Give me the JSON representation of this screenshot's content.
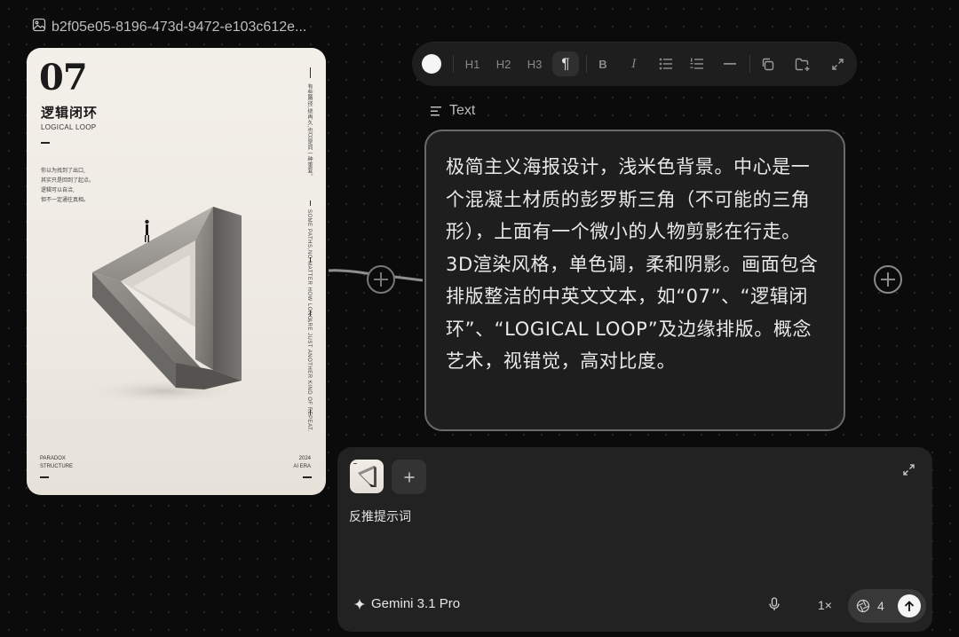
{
  "image_node": {
    "label": "b2f05e05-8196-473d-9472-e103c612e..."
  },
  "poster": {
    "number": "07",
    "title_cn": "逻辑闭环",
    "title_en": "LOGICAL LOOP",
    "poem_lines": [
      "你以为找到了出口,",
      "其实只是回到了起点。",
      "逻辑可以自洽,",
      "但不一定通往真相。"
    ],
    "vertical_cn": "有些路径,绕再久,也只是同一种重复。",
    "vertical_en_1": "SOME PATHS,",
    "vertical_en_2": "NO MATTER HOW LONG,",
    "vertical_en_3": "ARE JUST ANOTHER KIND OF REPEAT.",
    "footer_left": [
      "PARADOX",
      "STRUCTURE"
    ],
    "footer_right": [
      "2024",
      "AI ERA"
    ]
  },
  "toolbar": {
    "items": [
      {
        "name": "color-swatch",
        "label": ""
      },
      {
        "name": "h1-button",
        "label": "H1"
      },
      {
        "name": "h2-button",
        "label": "H2"
      },
      {
        "name": "h3-button",
        "label": "H3"
      },
      {
        "name": "paragraph-button",
        "label": "¶"
      },
      {
        "name": "bold-button",
        "label": "B"
      },
      {
        "name": "italic-button",
        "label": "I"
      }
    ],
    "active": "paragraph",
    "swatch_color": "#f5f5f5"
  },
  "text_node": {
    "label": "Text",
    "content": "极简主义海报设计，浅米色背景。中心是一个混凝土材质的彭罗斯三角（不可能的三角形），上面有一个微小的人物剪影在行走。3D渲染风格，单色调，柔和阴影。画面包含排版整洁的中英文文本，如“07”、“逻辑闭环”、“LOGICAL LOOP”及边缘排版。概念艺术，视错觉，高对比度。"
  },
  "prompt_panel": {
    "prompt": "反推提示词",
    "model_name": "Gemini 3.1 Pro",
    "speed": "1×",
    "credit_count": "4"
  },
  "colors": {
    "canvas_bg": "#0b0b0b",
    "panel_bg": "#222222",
    "card_border": "#6a6a6a",
    "poster_bg": "#f3efe9"
  }
}
